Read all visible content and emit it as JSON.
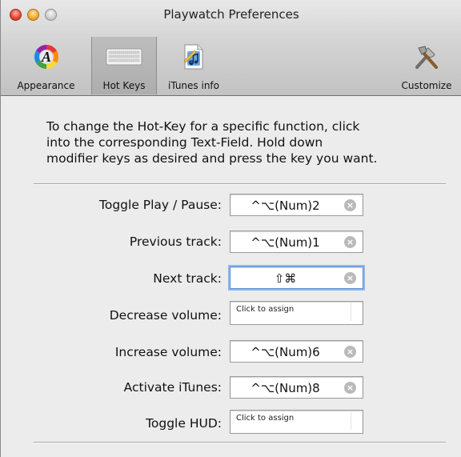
{
  "window": {
    "title": "Playwatch Preferences"
  },
  "toolbar": {
    "items": [
      {
        "label": "Appearance",
        "icon": "appearance-icon"
      },
      {
        "label": "Hot Keys",
        "icon": "keyboard-icon",
        "selected": true
      },
      {
        "label": "iTunes info",
        "icon": "itunes-document-icon"
      },
      {
        "label": "Customize",
        "icon": "tools-icon"
      }
    ]
  },
  "instructions": {
    "lines": [
      "To change the Hot-Key for a specific function, click",
      "into the corresponding Text-Field. Hold down",
      "modifier keys as desired and press the key you want."
    ]
  },
  "hotkeys": [
    {
      "label": "Toggle Play / Pause:",
      "value": "^⌥(Num)2"
    },
    {
      "label": "Previous track:",
      "value": "^⌥(Num)1"
    },
    {
      "label": "Next track:",
      "value": "⇧⌘",
      "focused": true
    },
    {
      "label": "Decrease volume:",
      "placeholder": "Click to assign"
    },
    {
      "label": "Increase volume:",
      "value": "^⌥(Num)6"
    },
    {
      "label": "Activate iTunes:",
      "value": "^⌥(Num)8"
    },
    {
      "label": "Toggle HUD:",
      "placeholder": "Click to assign"
    }
  ],
  "icons": {
    "clear": "clear-field-icon"
  },
  "colors": {
    "focus_ring": "#8fb6ee",
    "close": "#e3412f",
    "minimize": "#f2a92a"
  }
}
